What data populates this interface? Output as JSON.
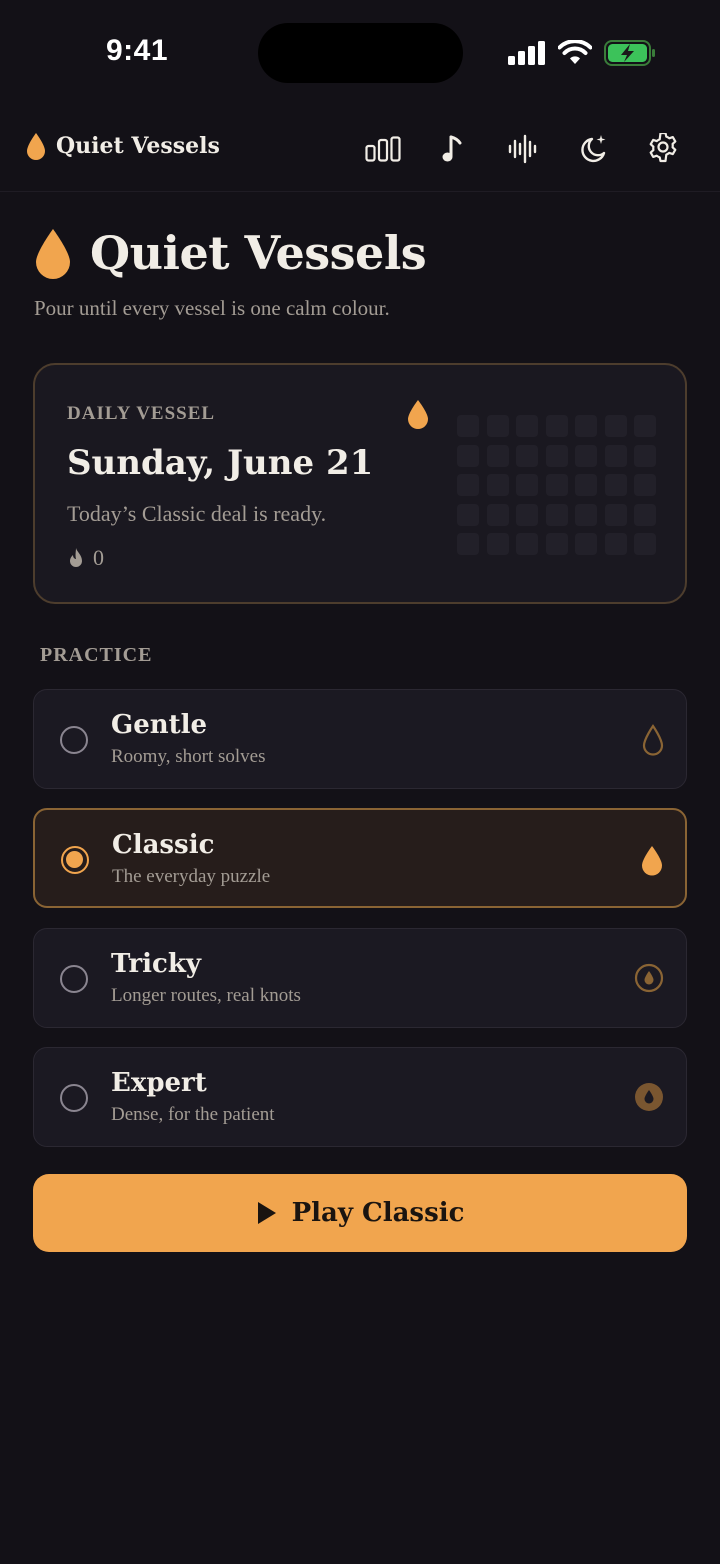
{
  "status_bar": {
    "time": "9:41"
  },
  "nav": {
    "brand_label": "Quiet Vessels",
    "actions": [
      "stats-icon",
      "music-icon",
      "sound-icon",
      "theme-icon",
      "settings-icon"
    ]
  },
  "hero": {
    "title": "Quiet Vessels",
    "subtitle": "Pour until every vessel is one calm colour."
  },
  "daily": {
    "kicker": "DAILY VESSEL",
    "date": "Sunday, June 21",
    "text": "Today’s Classic deal is ready.",
    "streak": "0"
  },
  "practice": {
    "label": "PRACTICE",
    "modes": [
      {
        "name": "Gentle",
        "desc": "Roomy, short solves",
        "selected": false
      },
      {
        "name": "Classic",
        "desc": "The everyday puzzle",
        "selected": true
      },
      {
        "name": "Tricky",
        "desc": "Longer routes, real knots",
        "selected": false
      },
      {
        "name": "Expert",
        "desc": "Dense, for the patient",
        "selected": false
      }
    ]
  },
  "play_button": {
    "label": "Play Classic"
  },
  "colors": {
    "accent": "#f1a54e",
    "background": "#131117",
    "card": "#1b1922"
  }
}
